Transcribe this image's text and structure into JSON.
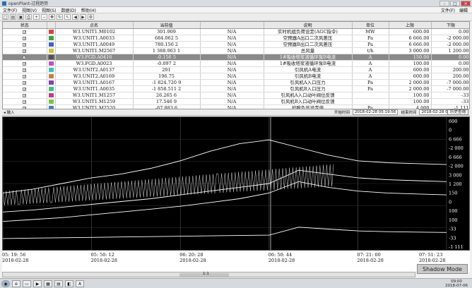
{
  "window": {
    "title": "openPlant-过程趋势",
    "min": "–",
    "max": "□",
    "close": "×"
  },
  "menu": {
    "items": [
      "文件(F)",
      "视图(V)",
      "视图(S)",
      "数据(D)",
      "帮助(H)"
    ],
    "right": [
      "文件(F)",
      "编辑"
    ]
  },
  "toolbar": {
    "buttons": [
      {
        "name": "new-icon",
        "glyph": "□"
      },
      {
        "name": "open-icon",
        "glyph": "▤"
      },
      {
        "name": "save-icon",
        "glyph": "▣"
      },
      {
        "name": "print-icon",
        "glyph": "⎙"
      },
      {
        "name": "zoom-in-icon",
        "glyph": "+"
      },
      {
        "name": "zoom-out-icon",
        "glyph": "−"
      },
      {
        "name": "pan-icon",
        "glyph": "✥"
      },
      {
        "name": "refresh-icon",
        "glyph": "↻"
      },
      {
        "name": "cursor-icon",
        "glyph": "↖"
      },
      {
        "name": "prev-icon",
        "glyph": "◀"
      },
      {
        "name": "next-icon",
        "glyph": "▶"
      },
      {
        "name": "settings-icon",
        "glyph": "⚙"
      }
    ]
  },
  "table": {
    "headers": [
      "状态",
      "",
      "点名",
      "当前值",
      "",
      "说明",
      "单位",
      "上限",
      "下限"
    ],
    "rows": [
      {
        "name": "W3.UNIT1.M0102",
        "value": "301.909",
        "status": "N/A",
        "desc": "实时机组负荷设定(AGC指令)",
        "unit": "MW",
        "high": "600.00",
        "low": "0.00",
        "color": "#e04040",
        "selected": false
      },
      {
        "name": "W3.UNIT1.A0033",
        "value": "684.062 5",
        "status": "N/A",
        "desc": "空预器A出口二次风差压",
        "unit": "Pa",
        "high": "6 666.00",
        "low": "-2 000.00",
        "color": "#40a040",
        "selected": false
      },
      {
        "name": "W3.UNIT1.A0049",
        "value": "780.156 2",
        "status": "N/A",
        "desc": "空预器B出口二次风差压",
        "unit": "Pa",
        "high": "6 666.00",
        "low": "-2 000.00",
        "color": "#4060d0",
        "selected": false
      },
      {
        "name": "W3.UNIT1.M2567",
        "value": "1 388.963 1",
        "status": "N/A",
        "desc": "总风量",
        "unit": "t/h",
        "high": "3 000.00",
        "low": "1 200.00",
        "color": "#d0c040",
        "selected": false
      },
      {
        "name": "W3.FGD.A0416",
        "value": "-0.156 5",
        "status": "N/A",
        "desc": "1#吸收塔浆液循环泵B电流",
        "unit": "A",
        "high": "150.00",
        "low": "0.00",
        "color": "#505050",
        "selected": true
      },
      {
        "name": "W3.FGD.A0023",
        "value": "-0.097 2",
        "status": "N/A",
        "desc": "1#吸收塔浆液循环泵B电流",
        "unit": "A",
        "high": "100.00",
        "low": "0.00",
        "color": "#c050c0",
        "selected": false
      },
      {
        "name": "W3.UNIT2.A0137",
        "value": "201",
        "status": "N/A",
        "desc": "引风机A电流",
        "unit": "A",
        "high": "600.00",
        "low": "200.00",
        "color": "#40c0c0",
        "selected": false
      },
      {
        "name": "W3.UNIT2.A0169",
        "value": "196.75",
        "status": "N/A",
        "desc": "引风机B电流",
        "unit": "A",
        "high": "600.00",
        "low": "200.00",
        "color": "#c08040",
        "selected": false
      },
      {
        "name": "W3.UNIT1.A0167",
        "value": "-1 824.720 9",
        "status": "N/A",
        "desc": "引风机A入口压力",
        "unit": "Pa",
        "high": "2 000.00",
        "low": "-7 000.00",
        "color": "#8040c0",
        "selected": false
      },
      {
        "name": "W3.UNIT1.A0035",
        "value": "-1 858.511 2",
        "status": "N/A",
        "desc": "引风机B入口压力",
        "unit": "Pa",
        "high": "2 000.00",
        "low": "-7 000.00",
        "color": "#40c080",
        "selected": false
      },
      {
        "name": "W3.UNIT1.M1257",
        "value": "26.265 6",
        "status": "N/A",
        "desc": "引风机A入口动叶阀位反馈",
        "unit": "",
        "high": "100.00",
        "low": "-33",
        "color": "#c04080",
        "selected": false
      },
      {
        "name": "W3.UNIT1.M1259",
        "value": "17.546 9",
        "status": "N/A",
        "desc": "引风机B入口动叶阀位反馈",
        "unit": "",
        "high": "100.00",
        "low": "-33",
        "color": "#80c040",
        "selected": false
      },
      {
        "name": "W3.UNIT1.M2520",
        "value": "-67.883 6",
        "status": "N/A",
        "desc": "炉膛负压设定值",
        "unit": "Pa",
        "high": "4 000",
        "low": "-1 111",
        "color": "#4080c0",
        "selected": false
      }
    ]
  },
  "status_row": {
    "left": "◂ 输入",
    "start_label": "开始时间",
    "start_value": "2018-02-28 05:19:56",
    "end_label": "结束时间",
    "end_value": "2018-02-28 07:51:23",
    "history_button": "历史查询"
  },
  "chart_data": {
    "type": "line",
    "x_start": "05:19:56",
    "x_end": "07:51:23",
    "x_ticks": [
      {
        "time": "05: 19: 56",
        "date": "2018-02-28"
      },
      {
        "time": "05: 50: 12",
        "date": "2018-02-28"
      },
      {
        "time": "06: 20: 28",
        "date": "2018-02-28"
      },
      {
        "time": "06: 50: 44",
        "date": "2018-02-28"
      },
      {
        "time": "07: 21: 00",
        "date": "2018-02-28"
      },
      {
        "time": "07: 51: 23",
        "date": "2018-02-28"
      }
    ],
    "y_right_labels": [
      "600",
      "0",
      "6 666",
      "-2 000",
      "6 666",
      "-2 000",
      "3 000",
      "1 200",
      "150",
      "0",
      "100",
      "100",
      "-33",
      "-33",
      "-1 111"
    ],
    "series": [
      {
        "color": "#ffffff",
        "values": [
          300,
          320,
          350,
          380,
          400,
          430,
          470,
          520,
          560,
          580,
          540,
          500,
          470,
          460,
          455,
          450
        ]
      },
      {
        "color": "#ffffff",
        "values": [
          200,
          210,
          225,
          240,
          255,
          270,
          290,
          310,
          330,
          350,
          420,
          400,
          380,
          370,
          365,
          360
        ]
      },
      {
        "color": "#ffffff",
        "values": [
          150,
          160,
          170,
          185,
          200,
          215,
          230,
          250,
          270,
          300,
          360,
          330,
          310,
          300,
          295,
          290
        ]
      },
      {
        "color": "#ffffff",
        "values": [
          60,
          62,
          64,
          66,
          68,
          70,
          72,
          74,
          76,
          78,
          120,
          110,
          100,
          96,
          94,
          92
        ]
      }
    ]
  },
  "scroll": {
    "label": "1:1"
  },
  "shadow_button": "Shadow Mode",
  "taskbar": {
    "apps": [
      {
        "name": "start-icon",
        "glyph": "◉"
      },
      {
        "name": "ie-icon",
        "glyph": "e"
      },
      {
        "name": "folder-icon",
        "glyph": "▭"
      },
      {
        "name": "media-icon",
        "glyph": "▶"
      },
      {
        "name": "app1-icon",
        "glyph": "▦"
      },
      {
        "name": "app2-icon",
        "glyph": "▤"
      },
      {
        "name": "app3-icon",
        "glyph": "◧"
      },
      {
        "name": "pdf-icon",
        "glyph": "A"
      }
    ],
    "clock_time": "09:00",
    "clock_date": "2018-07-06"
  }
}
